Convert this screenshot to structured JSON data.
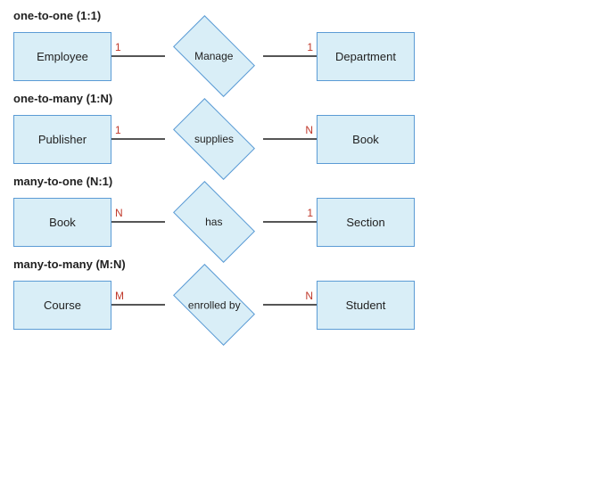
{
  "diagrams": [
    {
      "title": "one-to-one (1:1)",
      "left_entity": "Employee",
      "relationship": "Manage",
      "right_entity": "Department",
      "left_cardinality": "1",
      "right_cardinality": "1"
    },
    {
      "title": "one-to-many (1:N)",
      "left_entity": "Publisher",
      "relationship": "supplies",
      "right_entity": "Book",
      "left_cardinality": "1",
      "right_cardinality": "N"
    },
    {
      "title": "many-to-one (N:1)",
      "left_entity": "Book",
      "relationship": "has",
      "right_entity": "Section",
      "left_cardinality": "N",
      "right_cardinality": "1"
    },
    {
      "title": "many-to-many (M:N)",
      "left_entity": "Course",
      "relationship": "enrolled by",
      "right_entity": "Student",
      "left_cardinality": "M",
      "right_cardinality": "N"
    }
  ]
}
